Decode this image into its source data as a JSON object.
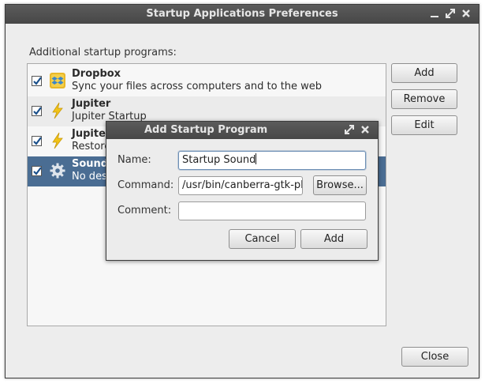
{
  "window": {
    "title": "Startup Applications Preferences",
    "section_label": "Additional startup programs:",
    "buttons": {
      "add": "Add",
      "remove": "Remove",
      "edit": "Edit",
      "close": "Close"
    }
  },
  "programs": [
    {
      "name": "Dropbox",
      "description": "Sync your files across computers and to the web",
      "enabled": true,
      "icon": "dropbox-icon"
    },
    {
      "name": "Jupiter",
      "description": "Jupiter Startup",
      "enabled": true,
      "icon": "lightning-icon"
    },
    {
      "name": "Jupiter",
      "description": "Restore",
      "enabled": true,
      "icon": "lightning-icon"
    },
    {
      "name": "Sound",
      "description": "No desc",
      "enabled": true,
      "icon": "gear-icon",
      "selected": true
    }
  ],
  "dialog": {
    "title": "Add Startup Program",
    "name_label": "Name:",
    "name_value": "Startup Sound",
    "command_label": "Command:",
    "command_value": "/usr/bin/canberra-gtk-pla",
    "browse_label": "Browse...",
    "comment_label": "Comment:",
    "comment_value": "",
    "cancel_label": "Cancel",
    "add_label": "Add"
  },
  "colors": {
    "selection": "#4a6d93",
    "titlebar": "#4f4f4f",
    "lightning": "#f2c318",
    "dropbox": "#3c86c9"
  }
}
